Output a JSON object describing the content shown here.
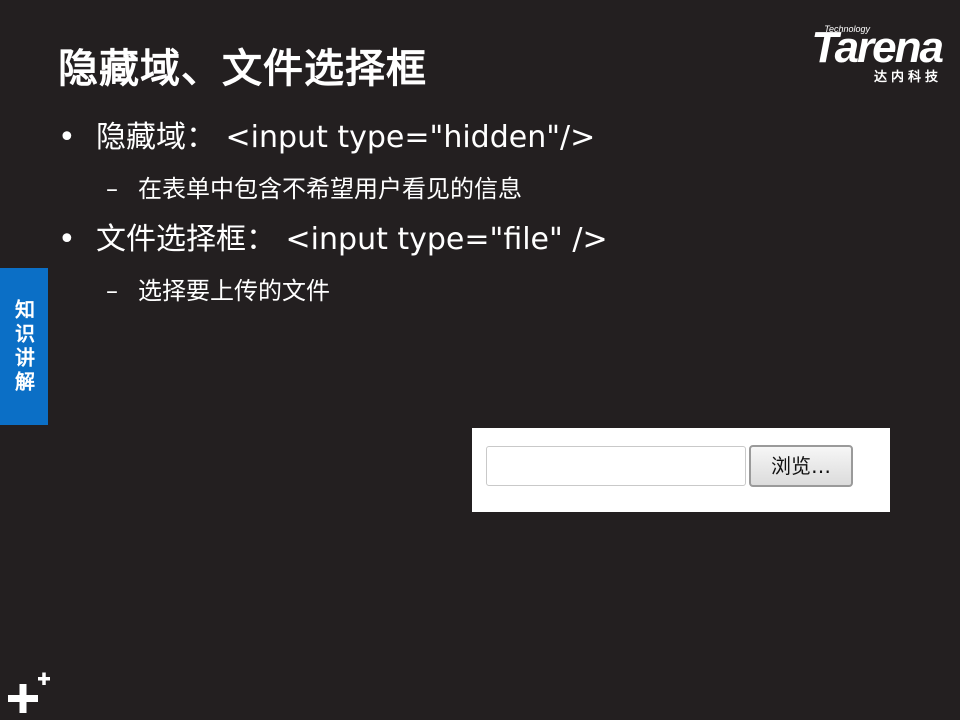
{
  "title": "隐藏域、文件选择框",
  "logo": {
    "brand": "Tarena",
    "tagline": "Technology",
    "cn": "达内科技"
  },
  "side_tab": {
    "label": "知识讲解"
  },
  "bullets": [
    {
      "text": "隐藏域： <input  type=\"hidden\"/>",
      "sub": [
        "在表单中包含不希望用户看见的信息"
      ]
    },
    {
      "text": "文件选择框： <input  type=\"file\" />",
      "sub": [
        "选择要上传的文件"
      ]
    }
  ],
  "file_demo": {
    "input_value": "",
    "button_label": "浏览…"
  },
  "colors": {
    "background": "#231f20",
    "tab": "#0b6fc6"
  }
}
